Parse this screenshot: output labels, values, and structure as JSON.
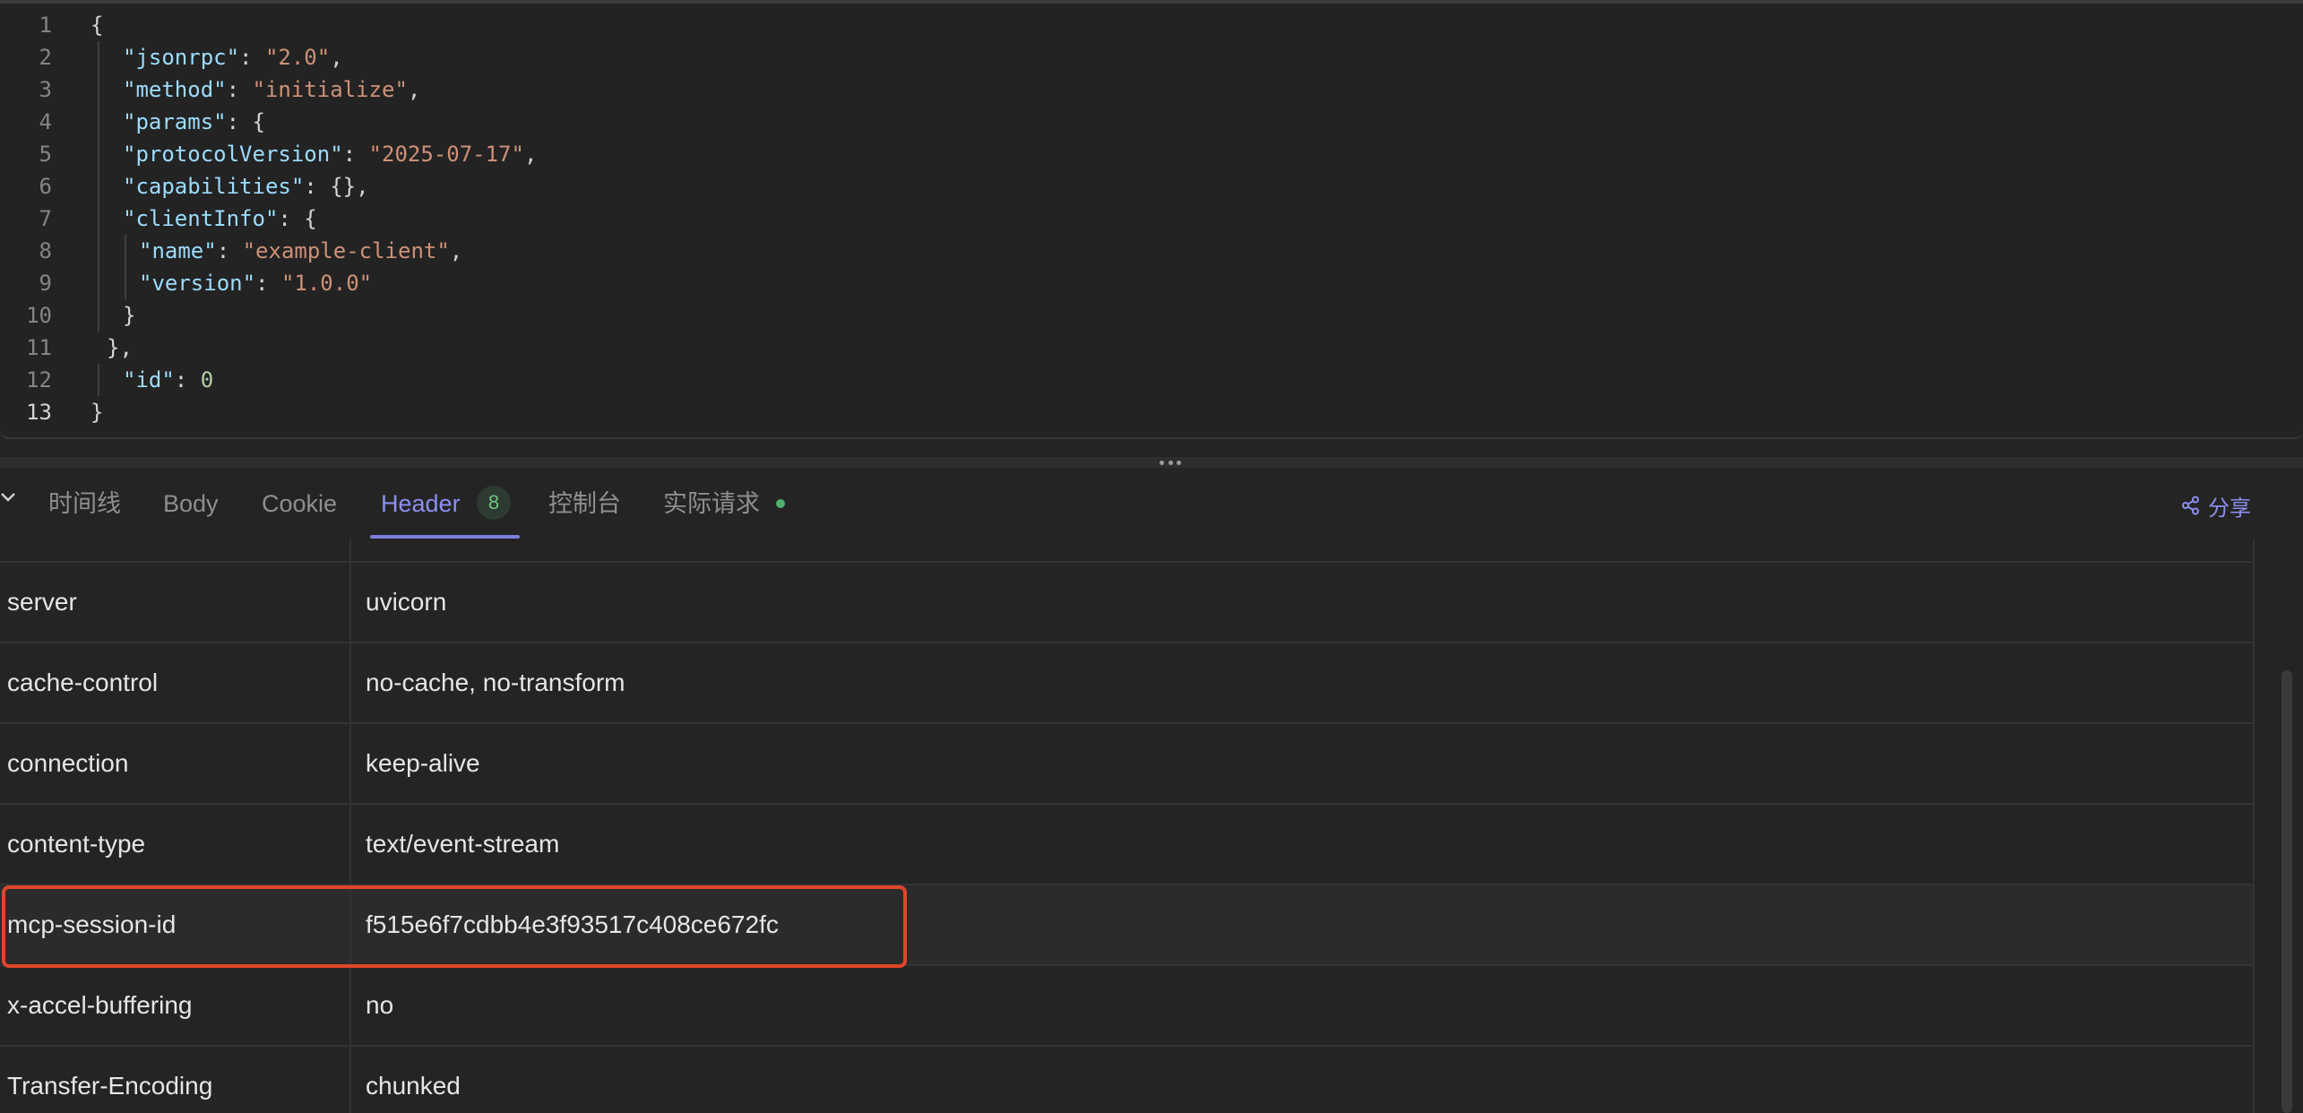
{
  "editor": {
    "lines": [
      {
        "num": "1",
        "indent": 0,
        "tokens": [
          {
            "t": "p",
            "v": "{"
          }
        ]
      },
      {
        "num": "2",
        "indent": 2,
        "tokens": [
          {
            "t": "k",
            "v": "\"jsonrpc\""
          },
          {
            "t": "p",
            "v": ": "
          },
          {
            "t": "s",
            "v": "\"2.0\""
          },
          {
            "t": "p",
            "v": ","
          }
        ]
      },
      {
        "num": "3",
        "indent": 2,
        "tokens": [
          {
            "t": "k",
            "v": "\"method\""
          },
          {
            "t": "p",
            "v": ": "
          },
          {
            "t": "s",
            "v": "\"initialize\""
          },
          {
            "t": "p",
            "v": ","
          }
        ]
      },
      {
        "num": "4",
        "indent": 2,
        "tokens": [
          {
            "t": "k",
            "v": "\"params\""
          },
          {
            "t": "p",
            "v": ": {"
          }
        ]
      },
      {
        "num": "5",
        "indent": 2,
        "tokens": [
          {
            "t": "k",
            "v": "\"protocolVersion\""
          },
          {
            "t": "p",
            "v": ": "
          },
          {
            "t": "s",
            "v": "\"2025-07-17\""
          },
          {
            "t": "p",
            "v": ","
          }
        ]
      },
      {
        "num": "6",
        "indent": 2,
        "tokens": [
          {
            "t": "k",
            "v": "\"capabilities\""
          },
          {
            "t": "p",
            "v": ": {},"
          }
        ]
      },
      {
        "num": "7",
        "indent": 2,
        "tokens": [
          {
            "t": "k",
            "v": "\"clientInfo\""
          },
          {
            "t": "p",
            "v": ": {"
          }
        ]
      },
      {
        "num": "8",
        "indent": 3,
        "tokens": [
          {
            "t": "k",
            "v": "\"name\""
          },
          {
            "t": "p",
            "v": ": "
          },
          {
            "t": "s",
            "v": "\"example-client\""
          },
          {
            "t": "p",
            "v": ","
          }
        ]
      },
      {
        "num": "9",
        "indent": 3,
        "tokens": [
          {
            "t": "k",
            "v": "\"version\""
          },
          {
            "t": "p",
            "v": ": "
          },
          {
            "t": "s",
            "v": "\"1.0.0\""
          }
        ]
      },
      {
        "num": "10",
        "indent": 2,
        "tokens": [
          {
            "t": "p",
            "v": "}"
          }
        ]
      },
      {
        "num": "11",
        "indent": 1,
        "tokens": [
          {
            "t": "p",
            "v": "},"
          }
        ]
      },
      {
        "num": "12",
        "indent": 2,
        "tokens": [
          {
            "t": "k",
            "v": "\"id\""
          },
          {
            "t": "p",
            "v": ": "
          },
          {
            "t": "n",
            "v": "0"
          }
        ]
      },
      {
        "num": "13",
        "indent": 0,
        "tokens": [
          {
            "t": "p",
            "v": "}"
          }
        ]
      }
    ]
  },
  "tabs": {
    "items": [
      {
        "label": "时间线"
      },
      {
        "label": "Body"
      },
      {
        "label": "Cookie"
      },
      {
        "label": "Header"
      },
      {
        "label": "控制台"
      },
      {
        "label": "实际请求"
      }
    ],
    "header_count": "8",
    "share_label": "分享"
  },
  "headers": [
    {
      "name": "server",
      "value": "uvicorn"
    },
    {
      "name": "cache-control",
      "value": "no-cache, no-transform"
    },
    {
      "name": "connection",
      "value": "keep-alive"
    },
    {
      "name": "content-type",
      "value": "text/event-stream"
    },
    {
      "name": "mcp-session-id",
      "value": "f515e6f7cdbb4e3f93517c408ce672fc"
    },
    {
      "name": "x-accel-buffering",
      "value": "no"
    },
    {
      "name": "Transfer-Encoding",
      "value": "chunked"
    }
  ],
  "colors": {
    "accent": "#8b8ff0",
    "highlight_border": "#e0452a",
    "status_dot": "#4fb06b"
  }
}
